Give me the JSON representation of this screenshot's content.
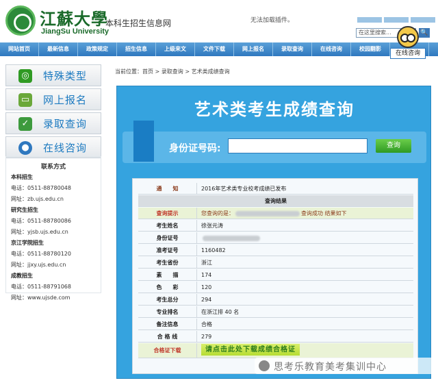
{
  "header": {
    "school_cn": "江蘇大學",
    "school_en": "JiangSu University",
    "site_name": "本科生招生信息网",
    "plugin_note": "无法加载插件。",
    "search_placeholder": "在这里搜索...",
    "search_button": "🔍"
  },
  "nav": {
    "items": [
      "网站首页",
      "最新信息",
      "政策规定",
      "招生信息",
      "上级来文",
      "文件下载",
      "网上报名",
      "录取查询",
      "在线咨询",
      "校园翻影"
    ]
  },
  "chat_widget": {
    "label": "在线咨询"
  },
  "sidebar": {
    "buttons": [
      {
        "label": "特殊类型",
        "icon": "special-type-icon",
        "color": "#2f9a23"
      },
      {
        "label": "网上报名",
        "icon": "computer-icon",
        "color": "#2f9a23"
      },
      {
        "label": "录取查询",
        "icon": "checklist-icon",
        "color": "#2f9a23"
      },
      {
        "label": "在线咨询",
        "icon": "person-icon",
        "color": "#2f78bf"
      }
    ],
    "contact_title": "联系方式",
    "contacts": [
      {
        "name": "本科招生",
        "phone": "电话：0511-88780048",
        "site": "网址：zb.ujs.edu.cn"
      },
      {
        "name": "研究生招生",
        "phone": "电话：0511-88780086",
        "site": "网址：yjsb.ujs.edu.cn"
      },
      {
        "name": "京江学院招生",
        "phone": "电话：0511-88780120",
        "site": "网址：jjxy.ujs.edu.cn"
      },
      {
        "name": "成教招生",
        "phone": "电话：0511-88791068",
        "site": "网址：www.ujsde.com"
      }
    ]
  },
  "breadcrumb": "当前位置：首页 > 录取查询 > 艺术类成绩查询",
  "query": {
    "title": "艺术类考生成绩查询",
    "id_label": "身份证号码:",
    "button": "查询"
  },
  "results": {
    "notice_label": "通　　知",
    "notice_value": "2016年艺术类专业校考成绩已发布",
    "section_header": "查询结果",
    "hint_label": "查询提示",
    "hint_prefix": "您查询的是：",
    "hint_suffix": "查询成功 结果如下",
    "rows": [
      {
        "label": "考生姓名",
        "value": "徐张元涛"
      },
      {
        "label": "身份证号",
        "value": ""
      },
      {
        "label": "准考证号",
        "value": "1160482"
      },
      {
        "label": "考生省份",
        "value": "浙江"
      },
      {
        "label": "素　　描",
        "value": "174"
      },
      {
        "label": "色　　彩",
        "value": "120"
      },
      {
        "label": "考生总分",
        "value": "294"
      },
      {
        "label": "专业排名",
        "value": "在浙江排 40 名"
      },
      {
        "label": "备注信息",
        "value": "合格"
      },
      {
        "label": "合 格 线",
        "value": "279"
      }
    ],
    "cert_label": "合格证下载",
    "cert_banner": "请点击此处下载成绩合格证"
  },
  "watermark": "思考乐教育美考集训中心"
}
